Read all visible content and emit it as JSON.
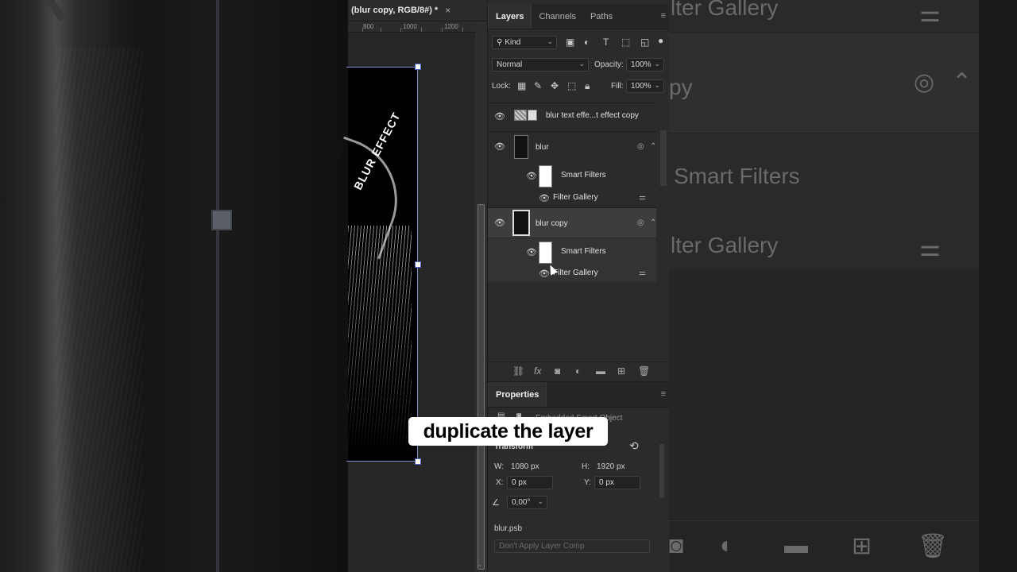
{
  "document": {
    "tab_title": "(blur copy, RGB/8#) *",
    "close_glyph": "×",
    "ruler_marks": [
      "800",
      "1000",
      "1200"
    ],
    "canvas_text": "BLUR EFFECT"
  },
  "layers_panel": {
    "tabs": [
      "Layers",
      "Channels",
      "Paths"
    ],
    "filter_kind": "Kind",
    "blend_mode": "Normal",
    "opacity_label": "Opacity:",
    "opacity_value": "100%",
    "lock_label": "Lock:",
    "fill_label": "Fill:",
    "fill_value": "100%",
    "layers": [
      {
        "name": "blur text effe...t effect copy"
      },
      {
        "name": "blur",
        "smart_filters": "Smart Filters",
        "filter": "Filter Gallery"
      },
      {
        "name": "blur copy",
        "smart_filters": "Smart Filters",
        "filter": "Filter Gallery",
        "selected": true
      }
    ]
  },
  "properties_panel": {
    "title": "Properties",
    "object_type": "Embedded Smart Object",
    "section": "Transform",
    "w_label": "W:",
    "w_value": "1080 px",
    "h_label": "H:",
    "h_value": "1920 px",
    "x_label": "X:",
    "x_value": "0 px",
    "y_label": "Y:",
    "y_value": "0 px",
    "angle_value": "0,00°",
    "file_name": "blur.psb",
    "layer_comp": "Don't Apply Layer Comp"
  },
  "background_right": {
    "texts": [
      "lter Gallery",
      "py",
      "Smart Filters",
      "lter Gallery"
    ]
  },
  "caption": "duplicate the layer",
  "colors": {
    "panel_bg": "#2b2b2b",
    "selected_layer": "#3d3d3d",
    "selection_handle": "#4a66c8"
  }
}
